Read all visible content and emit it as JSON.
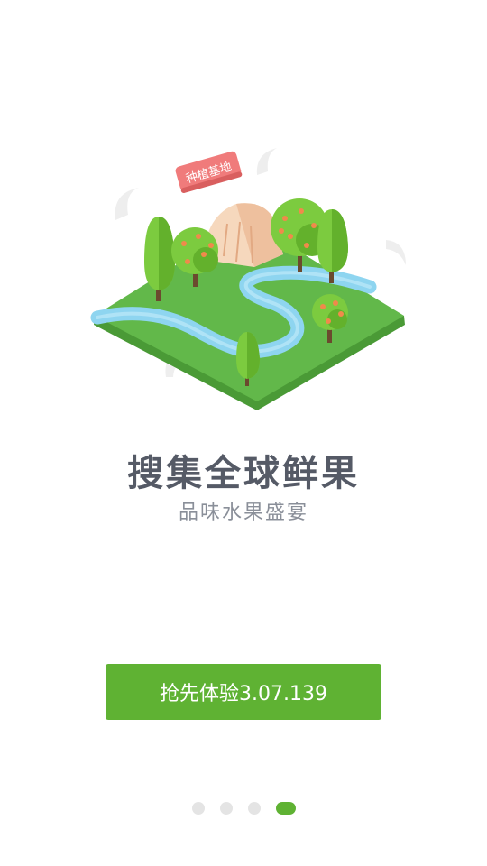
{
  "illustration": {
    "sign_label": "种植基地",
    "colors": {
      "grass": "#62b84a",
      "grass_side": "#4a9a36",
      "river": "#8ed5f0",
      "tree": "#7ccb3f",
      "fruit": "#f08a4b",
      "sign": "#f07b7b"
    }
  },
  "headline": "搜集全球鲜果",
  "subline": "品味水果盛宴",
  "cta": {
    "label": "抢先体验3.07.139"
  },
  "pager": {
    "count": 4,
    "active_index": 3
  }
}
